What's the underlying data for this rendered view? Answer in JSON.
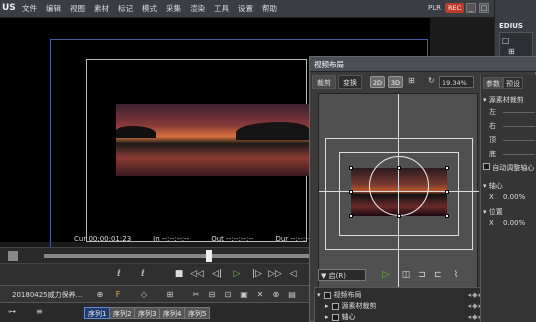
{
  "menubar": {
    "logo": "US",
    "items": [
      "文件",
      "编辑",
      "视图",
      "素材",
      "标记",
      "模式",
      "采集",
      "渲染",
      "工具",
      "设置",
      "帮助"
    ],
    "plr": "PLR",
    "rec": "REC",
    "win_min": "_",
    "win_max": "□"
  },
  "monitor": {
    "cur_label": "Cur",
    "cur_value": "00:00:01:23",
    "in_label": "In",
    "in_value": "--:--:--:--",
    "out_label": "Out",
    "out_value": "--:--:--:--",
    "dur_label": "Dur",
    "dur_value": "--:--:--:--"
  },
  "transport": {
    "buttons": [
      "ℓ",
      "ℓ",
      "■",
      "◁◁",
      "◁|",
      "▷",
      "|▷",
      "▷▷",
      "◁",
      "▷"
    ]
  },
  "timeline": {
    "project_name": "20180425威力保养...",
    "tools": [
      "⊕",
      "F",
      "◇",
      "⊞",
      "✂",
      "⊟",
      "⊡",
      "▣",
      "✕",
      "⊗",
      "▤",
      "≡",
      "⊞",
      "▦"
    ]
  },
  "sequences": [
    "序列1",
    "序列2",
    "序列3",
    "序列4",
    "序列5"
  ],
  "right_panel": {
    "title": "EDIUS",
    "tree_items": [
      "□",
      "⊞",
      "□",
      "□"
    ]
  },
  "dialog": {
    "title": "视频布局",
    "tabs": [
      "裁剪",
      "变换"
    ],
    "modes": [
      "2D",
      "3D"
    ],
    "zoom": "19.34%",
    "track_select": "▼ 启(R)",
    "param_tabs": [
      "参数",
      "预设"
    ],
    "crop_section": "源素材裁剪",
    "crop_left": "左",
    "crop_right": "右",
    "crop_top": "顶",
    "crop_bottom": "底",
    "auto_adjust": "自动调整轴心",
    "pivot_section": "轴心",
    "pivot_x_label": "X",
    "pivot_x_value": "0.00%",
    "position_section": "位置",
    "position_x_label": "X",
    "position_x_value": "0.00%",
    "kf_rows": [
      "视频布局",
      "源素材裁剪",
      "轴心"
    ]
  }
}
